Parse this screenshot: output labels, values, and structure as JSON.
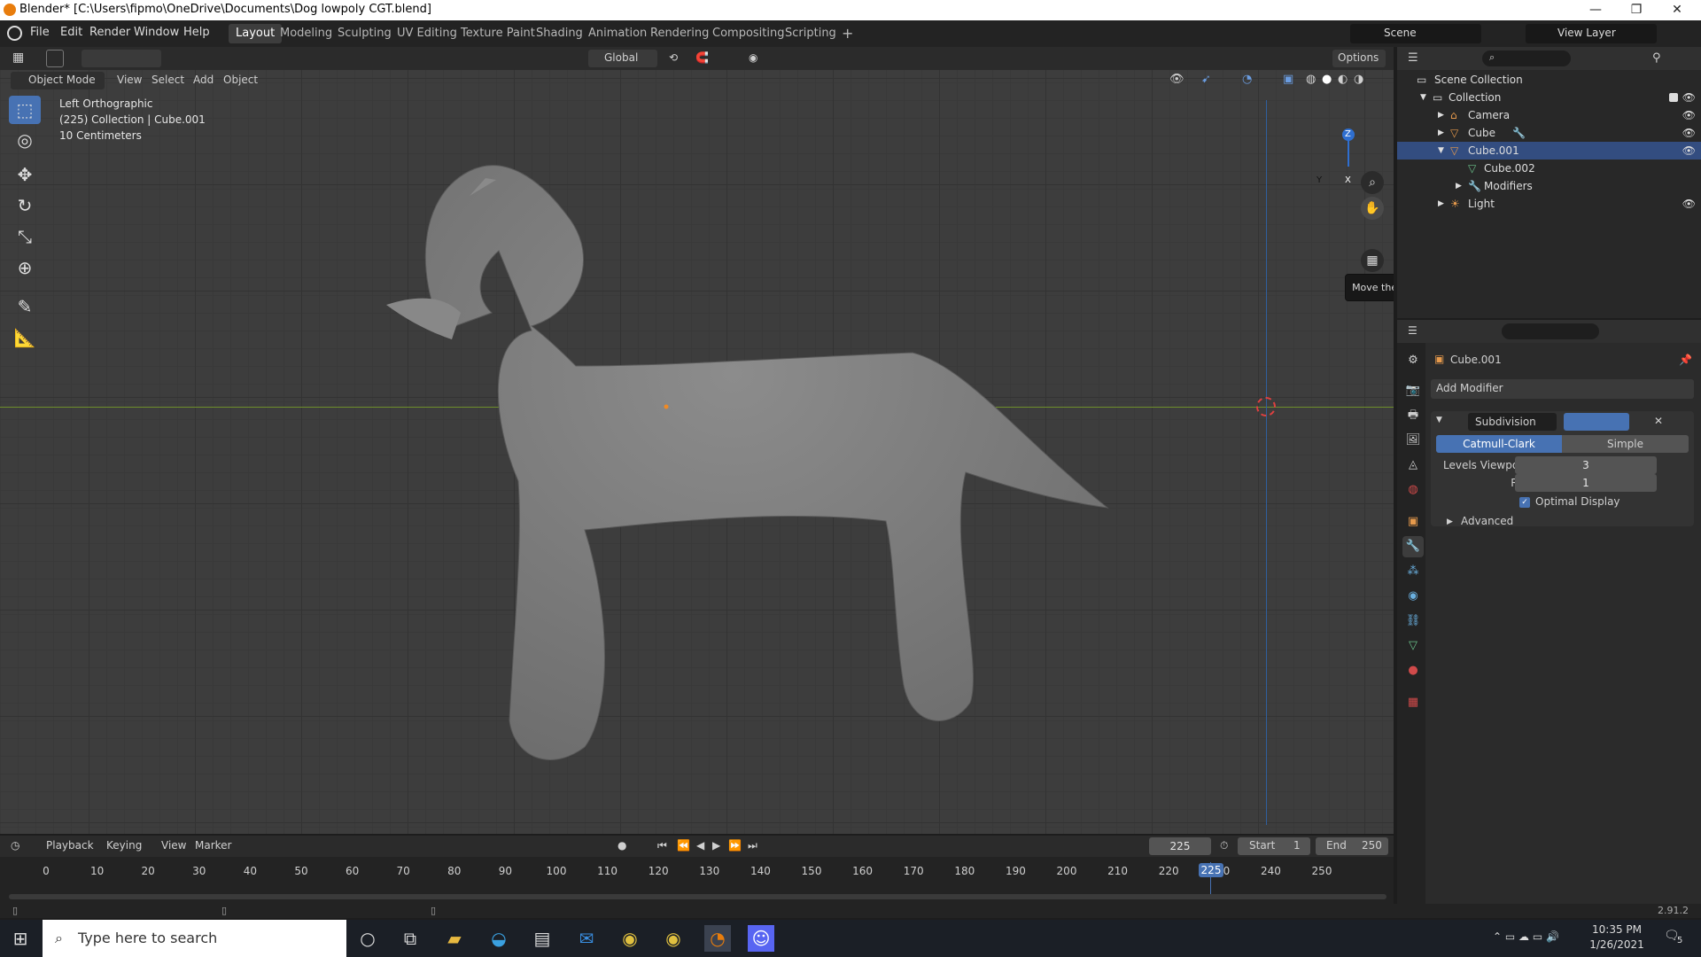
{
  "window": {
    "title": "Blender* [C:\\Users\\fipmo\\OneDrive\\Documents\\Dog lowpoly CGT.blend]",
    "minimize": "—",
    "restore": "❐",
    "close": "✕"
  },
  "menus": [
    "File",
    "Edit",
    "Render",
    "Window",
    "Help"
  ],
  "workspaces": [
    {
      "label": "Layout",
      "active": true
    },
    {
      "label": "Modeling"
    },
    {
      "label": "Sculpting"
    },
    {
      "label": "UV Editing"
    },
    {
      "label": "Texture Paint"
    },
    {
      "label": "Shading"
    },
    {
      "label": "Animation"
    },
    {
      "label": "Rendering"
    },
    {
      "label": "Compositing"
    },
    {
      "label": "Scripting"
    }
  ],
  "scene": {
    "label": "Scene",
    "view_layer": "View Layer"
  },
  "viewport": {
    "mode": "Object Mode",
    "header_menus": [
      "View",
      "Select",
      "Add",
      "Object"
    ],
    "transform": "Global",
    "options": "Options",
    "info_lines": [
      "Left Orthographic",
      "(225) Collection | Cube.001",
      "10 Centimeters"
    ],
    "tooltip": "Move the view",
    "axis_labels": {
      "z": "Z",
      "y": "Y",
      "x": "X"
    }
  },
  "outliner": {
    "rows": [
      {
        "label": "Scene Collection"
      },
      {
        "label": "Collection"
      },
      {
        "label": "Camera"
      },
      {
        "label": "Cube"
      },
      {
        "label": "Cube.001"
      },
      {
        "label": "Cube.002"
      },
      {
        "label": "Modifiers"
      },
      {
        "label": "Light"
      }
    ]
  },
  "properties": {
    "object_name": "Cube.001",
    "add_modifier": "Add Modifier",
    "modifier_name": "Subdivision",
    "tab_catmull": "Catmull-Clark",
    "tab_simple": "Simple",
    "levels_label": "Levels Viewport",
    "levels_value": "3",
    "render_label": "Render",
    "render_value": "1",
    "optimal_label": "Optimal Display",
    "advanced_label": "Advanced"
  },
  "timeline": {
    "menus": [
      "Playback",
      "Keying",
      "View",
      "Marker"
    ],
    "current_frame": "225",
    "start_label": "Start",
    "start": "1",
    "end_label": "End",
    "end": "250",
    "ticks": [
      "0",
      "10",
      "20",
      "30",
      "40",
      "50",
      "60",
      "70",
      "80",
      "90",
      "100",
      "110",
      "120",
      "130",
      "140",
      "150",
      "160",
      "170",
      "180",
      "190",
      "200",
      "210",
      "220",
      "230",
      "240",
      "250"
    ],
    "playhead": "225"
  },
  "status": {
    "version": "2.91.2"
  },
  "taskbar": {
    "search_placeholder": "Type here to search",
    "time": "10:35 PM",
    "date": "1/26/2021",
    "notifications": "5"
  }
}
